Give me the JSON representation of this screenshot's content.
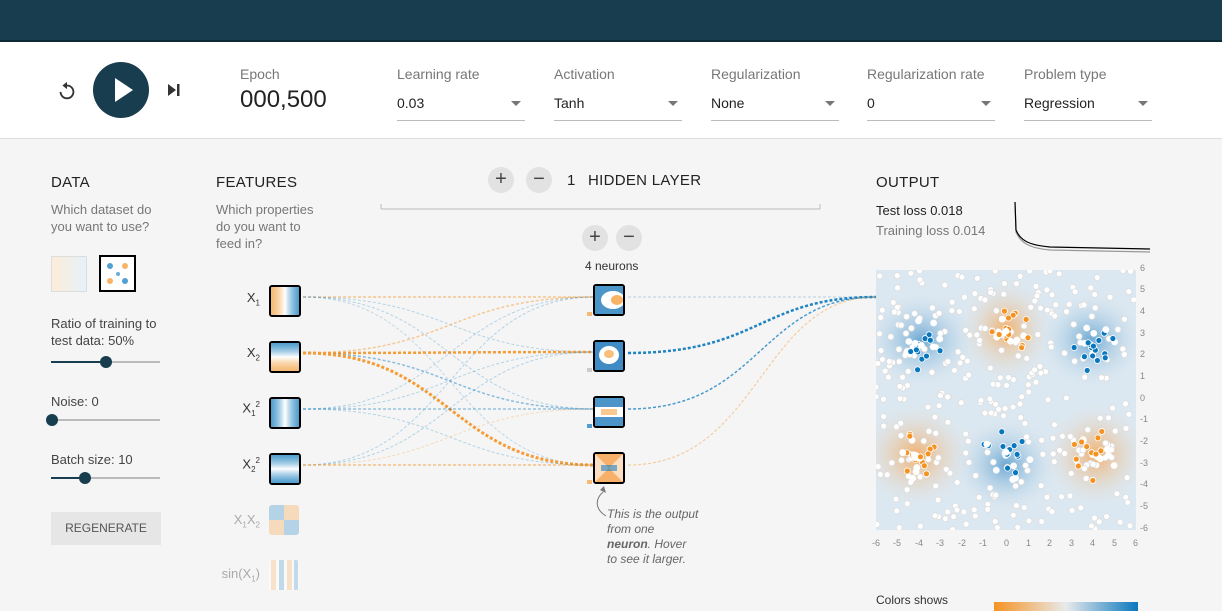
{
  "controls": {
    "epoch_label": "Epoch",
    "epoch_value": "000,500",
    "fields": [
      {
        "label": "Learning rate",
        "value": "0.03"
      },
      {
        "label": "Activation",
        "value": "Tanh"
      },
      {
        "label": "Regularization",
        "value": "None"
      },
      {
        "label": "Regularization rate",
        "value": "0"
      },
      {
        "label": "Problem type",
        "value": "Regression"
      }
    ]
  },
  "data_panel": {
    "heading": "DATA",
    "question_line1": "Which dataset do",
    "question_line2": "you want to use?",
    "ratio_line1": "Ratio of training to",
    "ratio_line2": "test data:  50%",
    "ratio_pct": 50,
    "noise_label": "Noise:  0",
    "noise_value": 0,
    "batch_label": "Batch size:  10",
    "batch_value": 10,
    "regenerate": "REGENERATE"
  },
  "features_panel": {
    "heading": "FEATURES",
    "q1": "Which properties",
    "q2": "do you want to",
    "q3": "feed in?",
    "features": [
      {
        "base": "X",
        "sub": "1",
        "sup": ""
      },
      {
        "base": "X",
        "sub": "2",
        "sup": ""
      },
      {
        "base": "X",
        "sub": "1",
        "sup": "2"
      },
      {
        "base": "X",
        "sub": "2",
        "sup": "2"
      },
      {
        "base": "X",
        "sub": "1",
        "base2": "X",
        "sub2": "2"
      },
      {
        "base": "sin(X",
        "sub": "1",
        "tail": ")"
      }
    ]
  },
  "network": {
    "layer_count": "1",
    "layer_label": "HIDDEN LAYER",
    "neuron_count": "4 neurons",
    "note_a": "This is the output",
    "note_b": "from one",
    "note_c": "neuron",
    "note_d": ". Hover",
    "note_e": "to see it larger."
  },
  "output": {
    "heading": "OUTPUT",
    "test_loss_label": "Test loss ",
    "test_loss": "0.018",
    "train_loss_label": "Training loss ",
    "train_loss": "0.014",
    "y_ticks": [
      "6",
      "5",
      "4",
      "3",
      "2",
      "1",
      "0",
      "-1",
      "-2",
      "-3",
      "-4",
      "-5",
      "-6"
    ],
    "x_ticks": [
      "-6",
      "-5",
      "-4",
      "-3",
      "-2",
      "-1",
      "0",
      "1",
      "2",
      "3",
      "4",
      "5",
      "6"
    ],
    "colors_label": "Colors shows"
  },
  "colors": {
    "orange": "#f59322",
    "blue": "#0877bd",
    "dark": "#183d4e"
  }
}
